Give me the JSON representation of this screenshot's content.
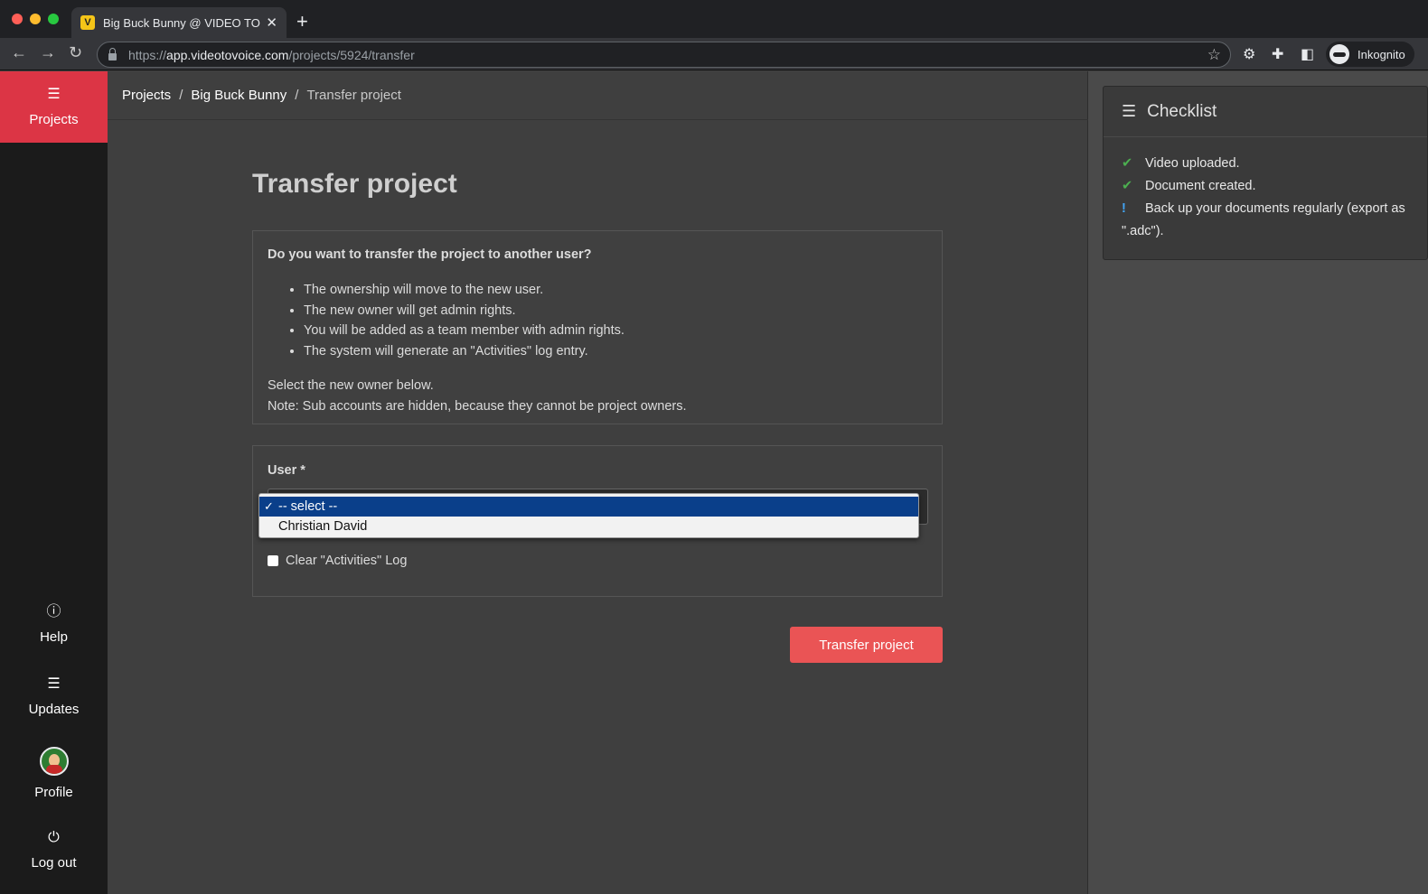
{
  "browser": {
    "tab_title": "Big Buck Bunny @ VIDEO TO V",
    "tab_favicon": "V",
    "url_prefix": "https://",
    "url_host": "app.videotovoice.com",
    "url_path": "/projects/5924/transfer",
    "profile_label": "Inkognito"
  },
  "sidebar": {
    "projects_label": "Projects",
    "help_label": "Help",
    "updates_label": "Updates",
    "profile_label": "Profile",
    "logout_label": "Log out"
  },
  "breadcrumb": {
    "projects": "Projects",
    "project_name": "Big Buck Bunny",
    "current": "Transfer project",
    "sep": "/"
  },
  "page": {
    "title": "Transfer project",
    "question": "Do you want to transfer the project to another user?",
    "bullets": [
      "The ownership will move to the new user.",
      "The new owner will get admin rights.",
      "You will be added as a team member with admin rights.",
      "The system will generate an \"Activities\" log entry."
    ],
    "note_1": "Select the new owner below.",
    "note_2": "Note: Sub accounts are hidden, because they cannot be project owners."
  },
  "user_field": {
    "label": "User *",
    "options": [
      "-- select --",
      "Christian David"
    ],
    "selected": "-- select --",
    "clear_log_label": "Clear \"Activities\" Log",
    "clear_log_checked": false
  },
  "actions": {
    "transfer_label": "Transfer project"
  },
  "checklist": {
    "title": "Checklist",
    "items": [
      {
        "status": "done",
        "text": "Video uploaded."
      },
      {
        "status": "done",
        "text": "Document created."
      },
      {
        "status": "warning",
        "text": "Back up your documents regularly (export as \".adc\")."
      }
    ]
  },
  "colors": {
    "accent": "#dc3545",
    "button": "#ea5455",
    "check": "#4caf50",
    "warning": "#42a5f5",
    "dropdown_selected": "#0a3f8a"
  }
}
